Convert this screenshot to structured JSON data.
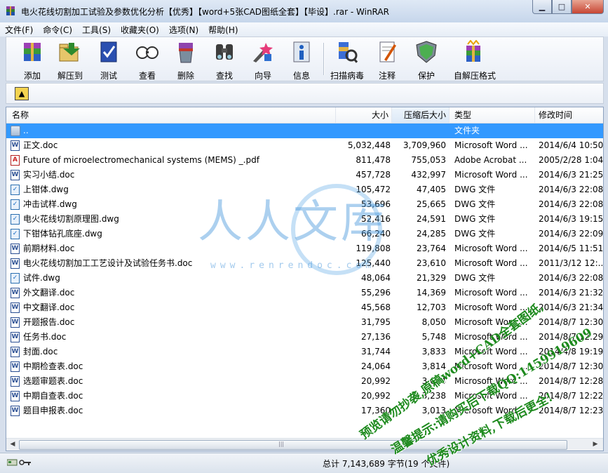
{
  "window": {
    "title": "电火花线切割加工试验及参数优化分析【优秀】【word+5张CAD图纸全套】【毕设】.rar - WinRAR",
    "min": "▁",
    "max": "□",
    "close": "✕"
  },
  "menu": [
    "文件(F)",
    "命令(C)",
    "工具(S)",
    "收藏夹(O)",
    "选项(N)",
    "帮助(H)"
  ],
  "toolbar": [
    {
      "label": "添加",
      "icon": "add-archive-icon"
    },
    {
      "label": "解压到",
      "icon": "extract-to-icon"
    },
    {
      "label": "测试",
      "icon": "test-icon"
    },
    {
      "label": "查看",
      "icon": "view-icon"
    },
    {
      "label": "删除",
      "icon": "delete-icon"
    },
    {
      "label": "查找",
      "icon": "find-icon"
    },
    {
      "label": "向导",
      "icon": "wizard-icon"
    },
    {
      "label": "信息",
      "icon": "info-icon"
    },
    {
      "label": "扫描病毒",
      "icon": "virus-scan-icon"
    },
    {
      "label": "注释",
      "icon": "comment-icon"
    },
    {
      "label": "保护",
      "icon": "protect-icon"
    },
    {
      "label": "自解压格式",
      "icon": "sfx-icon"
    }
  ],
  "columns": {
    "name": "名称",
    "size": "大小",
    "packed": "压缩后大小",
    "type": "类型",
    "modified": "修改时间"
  },
  "files": [
    {
      "name": "..",
      "size": "",
      "packed": "",
      "type": "文件夹",
      "modified": "",
      "kind": "folder"
    },
    {
      "name": "正文.doc",
      "size": "5,032,448",
      "packed": "3,709,960",
      "type": "Microsoft Word ...",
      "modified": "2014/6/4 10:50",
      "kind": "doc"
    },
    {
      "name": "Future of microelectromechanical systems (MEMS)  _.pdf",
      "size": "811,478",
      "packed": "755,053",
      "type": "Adobe Acrobat ...",
      "modified": "2005/2/28 1:04",
      "kind": "pdf"
    },
    {
      "name": "实习小结.doc",
      "size": "457,728",
      "packed": "432,997",
      "type": "Microsoft Word ...",
      "modified": "2014/6/3 21:25",
      "kind": "doc"
    },
    {
      "name": "上钳体.dwg",
      "size": "105,472",
      "packed": "47,405",
      "type": "DWG 文件",
      "modified": "2014/6/3 22:08",
      "kind": "dwg"
    },
    {
      "name": "冲击试样.dwg",
      "size": "53,696",
      "packed": "25,665",
      "type": "DWG 文件",
      "modified": "2014/6/3 22:08",
      "kind": "dwg"
    },
    {
      "name": "电火花线切割原理图.dwg",
      "size": "52,416",
      "packed": "24,591",
      "type": "DWG 文件",
      "modified": "2014/6/3 19:15",
      "kind": "dwg"
    },
    {
      "name": "下钳体钻孔底座.dwg",
      "size": "66,240",
      "packed": "24,285",
      "type": "DWG 文件",
      "modified": "2014/6/3 22:09",
      "kind": "dwg"
    },
    {
      "name": "前期材料.doc",
      "size": "119,808",
      "packed": "23,764",
      "type": "Microsoft Word ...",
      "modified": "2014/6/5 11:51",
      "kind": "doc"
    },
    {
      "name": "电火花线切割加工工艺设计及试验任务书.doc",
      "size": "125,440",
      "packed": "23,610",
      "type": "Microsoft Word ...",
      "modified": "2011/3/12 12:...",
      "kind": "doc"
    },
    {
      "name": "试件.dwg",
      "size": "48,064",
      "packed": "21,329",
      "type": "DWG 文件",
      "modified": "2014/6/3 22:08",
      "kind": "dwg"
    },
    {
      "name": "外文翻译.doc",
      "size": "55,296",
      "packed": "14,369",
      "type": "Microsoft Word ...",
      "modified": "2014/6/3 21:32",
      "kind": "doc"
    },
    {
      "name": "中文翻译.doc",
      "size": "45,568",
      "packed": "12,703",
      "type": "Microsoft Word ...",
      "modified": "2014/6/3 21:34",
      "kind": "doc"
    },
    {
      "name": "开题报告.doc",
      "size": "31,795",
      "packed": "8,050",
      "type": "Microsoft Word ...",
      "modified": "2014/8/7 12:30",
      "kind": "doc"
    },
    {
      "name": "任务书.doc",
      "size": "27,136",
      "packed": "5,748",
      "type": "Microsoft Word ...",
      "modified": "2014/8/7 12:29",
      "kind": "doc"
    },
    {
      "name": "封面.doc",
      "size": "31,744",
      "packed": "3,833",
      "type": "Microsoft Word ...",
      "modified": "2014/4/8 19:19",
      "kind": "doc"
    },
    {
      "name": "中期检查表.doc",
      "size": "24,064",
      "packed": "3,814",
      "type": "Microsoft Word ...",
      "modified": "2014/8/7 12:30",
      "kind": "doc"
    },
    {
      "name": "选题审题表.doc",
      "size": "20,992",
      "packed": "3,624",
      "type": "Microsoft Word ...",
      "modified": "2014/8/7 12:28",
      "kind": "doc"
    },
    {
      "name": "中期自查表.doc",
      "size": "20,992",
      "packed": "3,238",
      "type": "Microsoft Word ...",
      "modified": "2014/8/7 12:22",
      "kind": "doc"
    },
    {
      "name": "题目申报表.doc",
      "size": "17,360",
      "packed": "3,013",
      "type": "Microsoft Word ...",
      "modified": "2014/8/7 12:23",
      "kind": "doc"
    }
  ],
  "status": {
    "text": "总计 7,143,689 字节(19 个文件)"
  },
  "watermark": {
    "brand": "人人文库",
    "url": "www.renrendoc.com",
    "line1": "预览请勿抄袭,原稿word+CAD全套图纸,",
    "line2": "温馨提示:请购买后下载QQ:1459919609",
    "line3": "优秀设计资料,下载后更全!"
  },
  "colors": {
    "selection": "#3399ff",
    "watermark_green": "#1d8a1d"
  }
}
